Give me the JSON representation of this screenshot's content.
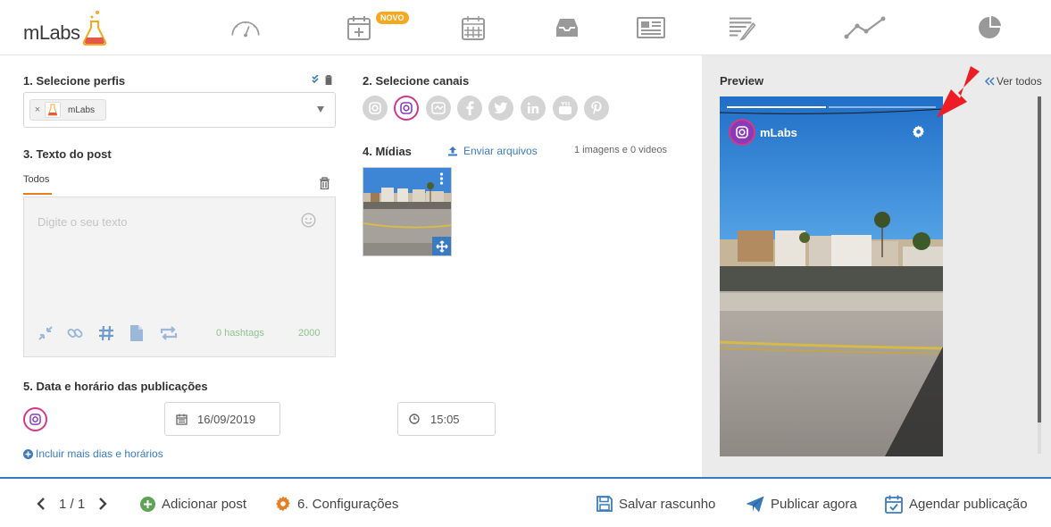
{
  "brand": {
    "logo_text": "mLabs",
    "accent": "#c7313b",
    "link_color": "#3a7bbf",
    "tab_accent": "#e67e22"
  },
  "nav": {
    "items": [
      {
        "icon": "dashboard-gauge-icon"
      },
      {
        "icon": "calendar-add-icon",
        "badge": "NOVO"
      },
      {
        "icon": "calendar-icon"
      },
      {
        "icon": "inbox-icon"
      },
      {
        "icon": "newspaper-icon"
      },
      {
        "icon": "edit-list-icon"
      },
      {
        "icon": "line-chart-icon"
      },
      {
        "icon": "pie-chart-icon"
      }
    ]
  },
  "step1": {
    "title": "1. Selecione perfis",
    "selected_profile": "mLabs"
  },
  "step2": {
    "title": "2. Selecione canais",
    "channels": [
      "instagram",
      "instagram-stories",
      "instagram-igtv",
      "facebook",
      "twitter",
      "linkedin",
      "youtube",
      "pinterest"
    ]
  },
  "step3": {
    "title": "3. Texto do post",
    "tab": "Todos",
    "placeholder": "Digite o seu texto",
    "hashtags": "0 hashtags",
    "char_limit": "2000"
  },
  "step4": {
    "title": "4. Mídias",
    "upload_label": "Enviar arquivos",
    "media_count": "1 imagens e 0 videos"
  },
  "step5": {
    "title": "5. Data e horário das publicações",
    "date": "16/09/2019",
    "time": "15:05",
    "add_more": "Incluir mais dias e horários"
  },
  "preview": {
    "title": "Preview",
    "view_all": "Ver todos",
    "account_name": "mLabs"
  },
  "footer": {
    "pagination": "1 / 1",
    "add_post": "Adicionar post",
    "settings": "6. Configurações",
    "save_draft": "Salvar rascunho",
    "publish_now": "Publicar agora",
    "schedule": "Agendar publicação"
  }
}
